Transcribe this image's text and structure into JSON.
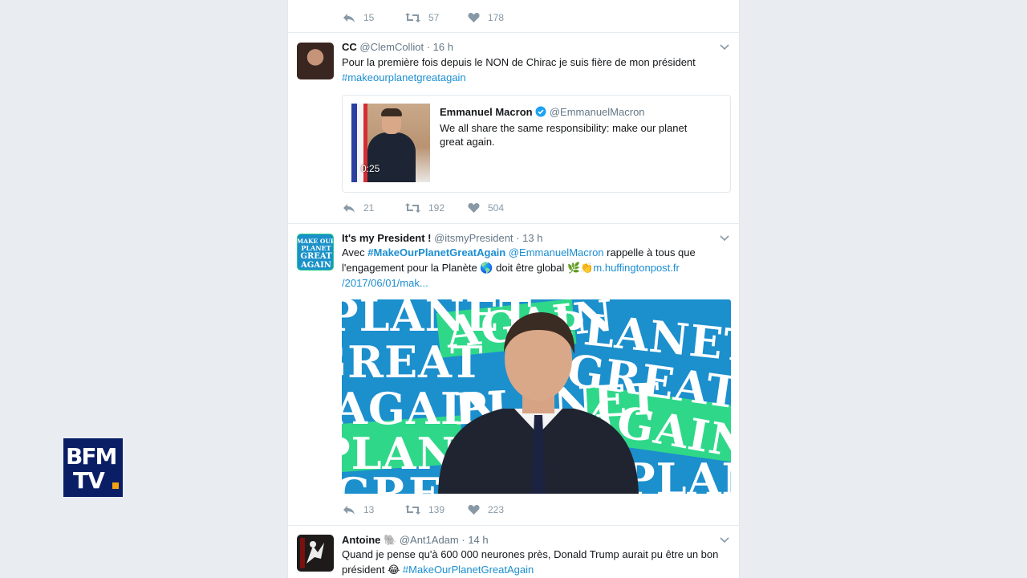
{
  "top_actions": {
    "reply": "15",
    "retweet": "57",
    "like": "178"
  },
  "tweet1": {
    "name": "CC",
    "handle": "@ClemColliot",
    "time": "16 h",
    "text": "Pour la première fois depuis le NON de Chirac je suis fière de mon président",
    "hashtag": "#makeourplanetgreatagain",
    "quote": {
      "name": "Emmanuel Macron",
      "handle": "@EmmanuelMacron",
      "text": "We all share the same responsibility: make our planet great again.",
      "duration": "0:25"
    },
    "actions": {
      "reply": "21",
      "retweet": "192",
      "like": "504"
    }
  },
  "tweet2": {
    "name": "It's my President !",
    "handle": "@itsmyPresident",
    "time": "13 h",
    "avatar_text": "MAKE OUR PLANET GREAT AGAIN",
    "text_pre": "Avec ",
    "hashtag": "#MakeOurPlanetGreatAgain",
    "mention": "@EmmanuelMacron",
    "text_mid": " rappelle à tous que l'engagement pour la Planète ",
    "globe": "🌎",
    "text_mid2": " doit être global ",
    "emojis": "🌿👏",
    "link": "m.huffingtonpost.fr /2017/06/01/mak...",
    "media_words": [
      "PLANET",
      "GREAT",
      "AGAIN"
    ],
    "actions": {
      "reply": "13",
      "retweet": "139",
      "like": "223"
    }
  },
  "tweet3": {
    "name": "Antoine",
    "name_emoji": "🐘",
    "handle": "@Ant1Adam",
    "time": "14 h",
    "text": "Quand je pense qu'à 600 000 neurones près, Donald Trump aurait pu être un bon président ",
    "emoji": "😂",
    "hashtag": "#MakeOurPlanetGreatAgain"
  },
  "logo": {
    "line1": "BFM",
    "line2": "TV"
  },
  "colors": {
    "link": "#1b8ed1",
    "verified": "#1da1f2",
    "bfm_bg": "#0a1e66",
    "bfm_accent": "#f2a30f"
  }
}
